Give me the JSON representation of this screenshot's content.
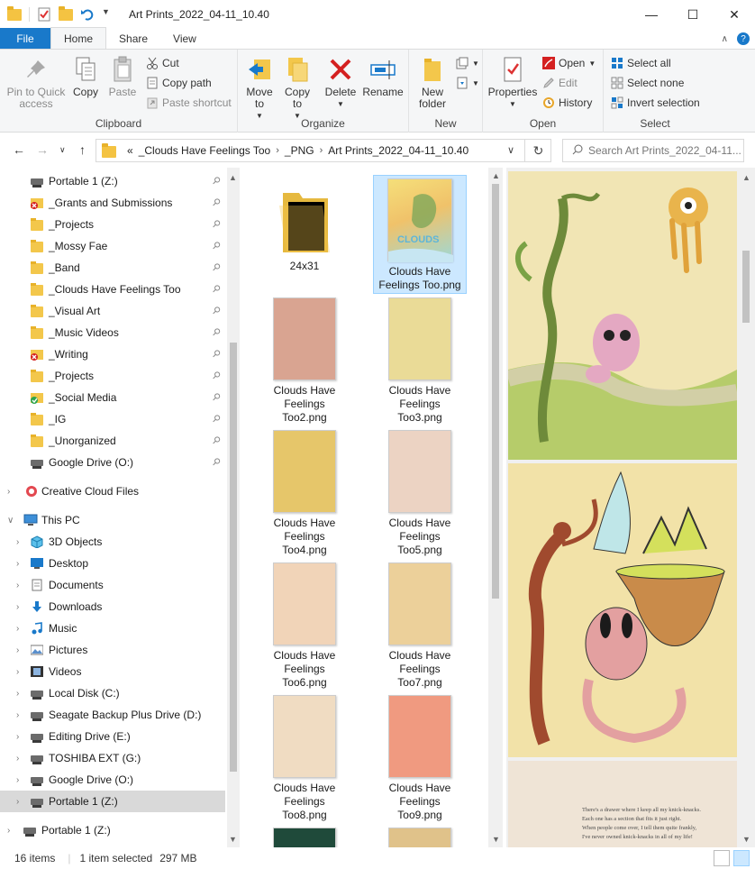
{
  "window": {
    "title": "Art Prints_2022_04-11_10.40",
    "minimize": "—",
    "maximize": "☐",
    "close": "✕"
  },
  "ribbon_tabs": [
    "File",
    "Home",
    "Share",
    "View"
  ],
  "ribbon": {
    "clipboard": {
      "pin_label": "Pin to Quick access",
      "copy_label": "Copy",
      "paste_label": "Paste",
      "cut_label": "Cut",
      "copy_path_label": "Copy path",
      "paste_shortcut_label": "Paste shortcut",
      "group_label": "Clipboard"
    },
    "organize": {
      "move_to_label": "Move to",
      "copy_to_label": "Copy to",
      "delete_label": "Delete",
      "rename_label": "Rename",
      "group_label": "Organize"
    },
    "new": {
      "new_folder_label": "New folder",
      "group_label": "New"
    },
    "open": {
      "properties_label": "Properties",
      "open_label": "Open",
      "edit_label": "Edit",
      "history_label": "History",
      "group_label": "Open"
    },
    "select": {
      "select_all_label": "Select all",
      "select_none_label": "Select none",
      "invert_label": "Invert selection",
      "group_label": "Select"
    }
  },
  "address": {
    "overflow": "«",
    "crumbs": [
      "_Clouds Have Feelings Too",
      "_PNG",
      "Art Prints_2022_04-11_10.40"
    ],
    "search_placeholder": "Search Art Prints_2022_04-11..."
  },
  "nav": {
    "quick_access": [
      {
        "label": "Portable 1 (Z:)",
        "icon": "drive-icon"
      },
      {
        "label": "_Grants and Submissions",
        "icon": "folder-error-icon"
      },
      {
        "label": "_Projects",
        "icon": "folder-icon"
      },
      {
        "label": "_Mossy Fae",
        "icon": "folder-icon"
      },
      {
        "label": "_Band",
        "icon": "folder-icon"
      },
      {
        "label": "_Clouds Have Feelings Too",
        "icon": "folder-icon"
      },
      {
        "label": "_Visual Art",
        "icon": "folder-icon"
      },
      {
        "label": "_Music Videos",
        "icon": "folder-icon"
      },
      {
        "label": "_Writing",
        "icon": "folder-error-icon"
      },
      {
        "label": "_Projects",
        "icon": "folder-icon"
      },
      {
        "label": "_Social Media",
        "icon": "folder-sync-icon"
      },
      {
        "label": "_IG",
        "icon": "folder-icon"
      },
      {
        "label": "_Unorganized",
        "icon": "folder-icon"
      },
      {
        "label": "Google Drive (O:)",
        "icon": "drive-icon"
      }
    ],
    "creative_cloud": "Creative Cloud Files",
    "this_pc": "This PC",
    "pc_items": [
      {
        "label": "3D Objects",
        "icon": "cube-icon"
      },
      {
        "label": "Desktop",
        "icon": "desktop-icon"
      },
      {
        "label": "Documents",
        "icon": "documents-icon"
      },
      {
        "label": "Downloads",
        "icon": "downloads-icon"
      },
      {
        "label": "Music",
        "icon": "music-icon"
      },
      {
        "label": "Pictures",
        "icon": "pictures-icon"
      },
      {
        "label": "Videos",
        "icon": "videos-icon"
      },
      {
        "label": "Local Disk (C:)",
        "icon": "drive-icon"
      },
      {
        "label": "Seagate Backup Plus Drive (D:)",
        "icon": "drive-icon"
      },
      {
        "label": "Editing Drive (E:)",
        "icon": "drive-icon"
      },
      {
        "label": "TOSHIBA EXT (G:)",
        "icon": "drive-icon"
      },
      {
        "label": "Google Drive (O:)",
        "icon": "drive-icon"
      },
      {
        "label": "Portable 1 (Z:)",
        "icon": "drive-icon"
      }
    ],
    "root_portable": "Portable 1 (Z:)"
  },
  "files": [
    {
      "name": "24x31",
      "type": "folder"
    },
    {
      "name": "Clouds Have Feelings Too.png",
      "type": "image",
      "selected": true,
      "tone": "#f2d36b"
    },
    {
      "name": "Clouds Have Feelings Too2.png",
      "type": "image",
      "tone": "#d9a491"
    },
    {
      "name": "Clouds Have Feelings Too3.png",
      "type": "image",
      "tone": "#eadb97"
    },
    {
      "name": "Clouds Have Feelings Too4.png",
      "type": "image",
      "tone": "#e6c66a"
    },
    {
      "name": "Clouds Have Feelings Too5.png",
      "type": "image",
      "tone": "#ecd3c3"
    },
    {
      "name": "Clouds Have Feelings Too6.png",
      "type": "image",
      "tone": "#f1d4b8"
    },
    {
      "name": "Clouds Have Feelings Too7.png",
      "type": "image",
      "tone": "#ecd09a"
    },
    {
      "name": "Clouds Have Feelings Too8.png",
      "type": "image",
      "tone": "#f0dcc2"
    },
    {
      "name": "Clouds Have Feelings Too9.png",
      "type": "image",
      "tone": "#f09a80"
    }
  ],
  "preview_text": [
    "There's a drawer where I keep all my knick-knacks.",
    "Each one has a section that fits it just right.",
    "When people come over, I tell them quite frankly,",
    "I've never owned knick-knacks in all of my life!"
  ],
  "status": {
    "count": "16 items",
    "selection": "1 item selected",
    "size": "297 MB"
  },
  "colors": {
    "accent": "#1979ca",
    "selection": "#cce8ff",
    "folder": "#f3c74b"
  }
}
